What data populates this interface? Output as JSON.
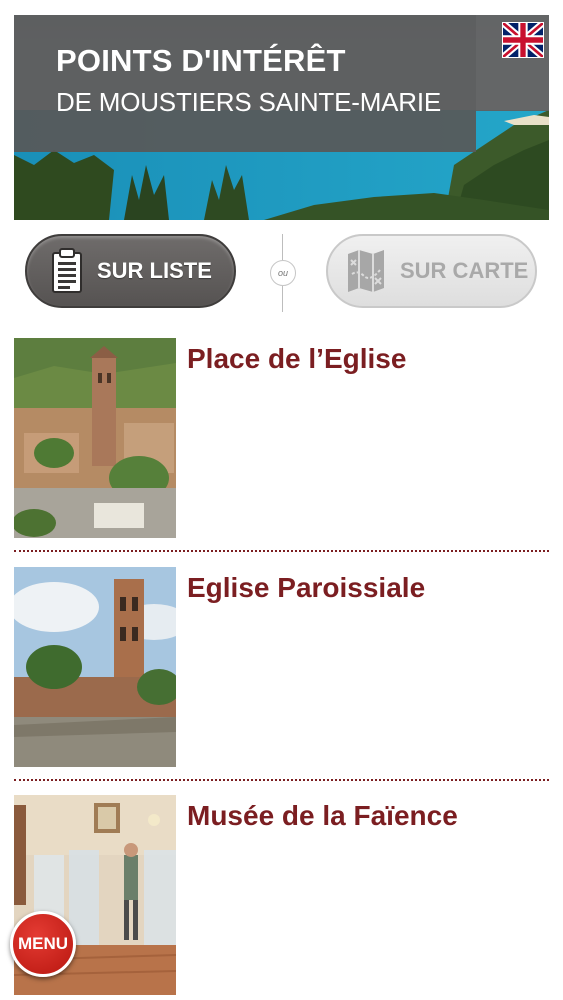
{
  "header": {
    "title": "POINTS D'INTÉRÊT",
    "subtitle": "DE MOUSTIERS SAINTE-MARIE",
    "language_flag_icon": "uk-flag-icon"
  },
  "toggle": {
    "list_label": "SUR LISTE",
    "or_label": "ou",
    "map_label": "SUR CARTE"
  },
  "points": [
    {
      "title": "Place de l’Eglise"
    },
    {
      "title": "Eglise Paroissiale"
    },
    {
      "title": "Musée de la Faïence"
    }
  ],
  "menu": {
    "label": "MENU"
  },
  "colors": {
    "accent": "#7b1e21",
    "menu_red": "#d42a22",
    "active_button": "#5f5c5b",
    "inactive_button": "#e6e6e6"
  }
}
